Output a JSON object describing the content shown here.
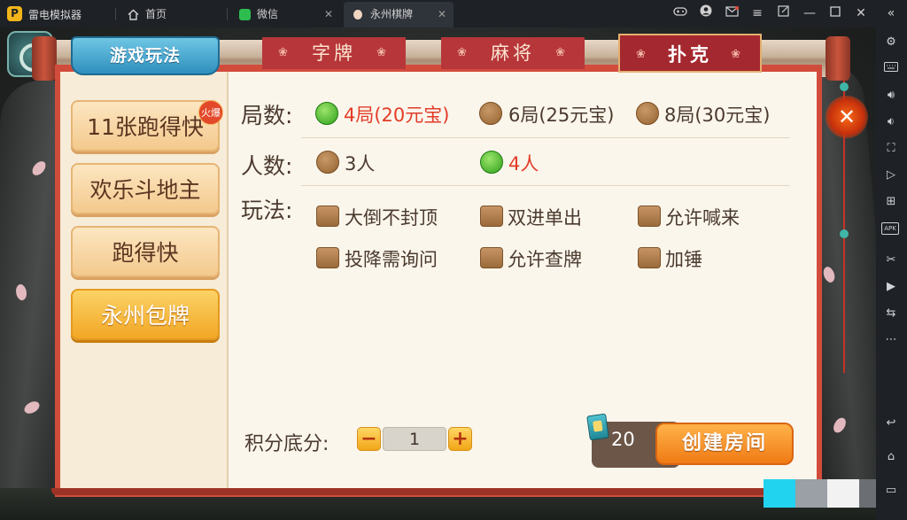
{
  "emulator": {
    "app_name": "雷电模拟器",
    "tabs": [
      {
        "label": "首页"
      },
      {
        "label": "微信"
      },
      {
        "label": "永州棋牌"
      }
    ],
    "close_glyph": "✕"
  },
  "toolbar": {
    "apk_label": "APK"
  },
  "game": {
    "header_tab": "游戏玩法",
    "categories": [
      {
        "label": "字牌"
      },
      {
        "label": "麻将"
      },
      {
        "label": "扑克",
        "selected": true
      }
    ],
    "games": [
      {
        "label": "11张跑得快",
        "badge": "火爆"
      },
      {
        "label": "欢乐斗地主"
      },
      {
        "label": "跑得快"
      },
      {
        "label": "永州包牌",
        "selected": true
      }
    ],
    "rounds": {
      "label": "局数:",
      "options": [
        {
          "label": "4局(20元宝)",
          "selected": true
        },
        {
          "label": "6局(25元宝)"
        },
        {
          "label": "8局(30元宝)"
        }
      ]
    },
    "players": {
      "label": "人数:",
      "options": [
        {
          "label": "3人"
        },
        {
          "label": "4人",
          "selected": true
        }
      ]
    },
    "rules": {
      "label": "玩法:",
      "options": [
        {
          "label": "大倒不封顶",
          "checked": false
        },
        {
          "label": "双进单出",
          "checked": false
        },
        {
          "label": "允许喊来",
          "checked": false
        },
        {
          "label": "投降需询问",
          "checked": false
        },
        {
          "label": "允许查牌",
          "checked": false
        },
        {
          "label": "加锤",
          "checked": false
        }
      ]
    },
    "score": {
      "label": "积分底分:",
      "value": "1",
      "minus": "−",
      "plus": "+"
    },
    "cost": "20",
    "create_button": "创建房间",
    "close_glyph": "✕"
  },
  "colors": {
    "accent_red": "#d24c3c",
    "selected_option": "#e23c28",
    "create_button": "#f07a14"
  }
}
